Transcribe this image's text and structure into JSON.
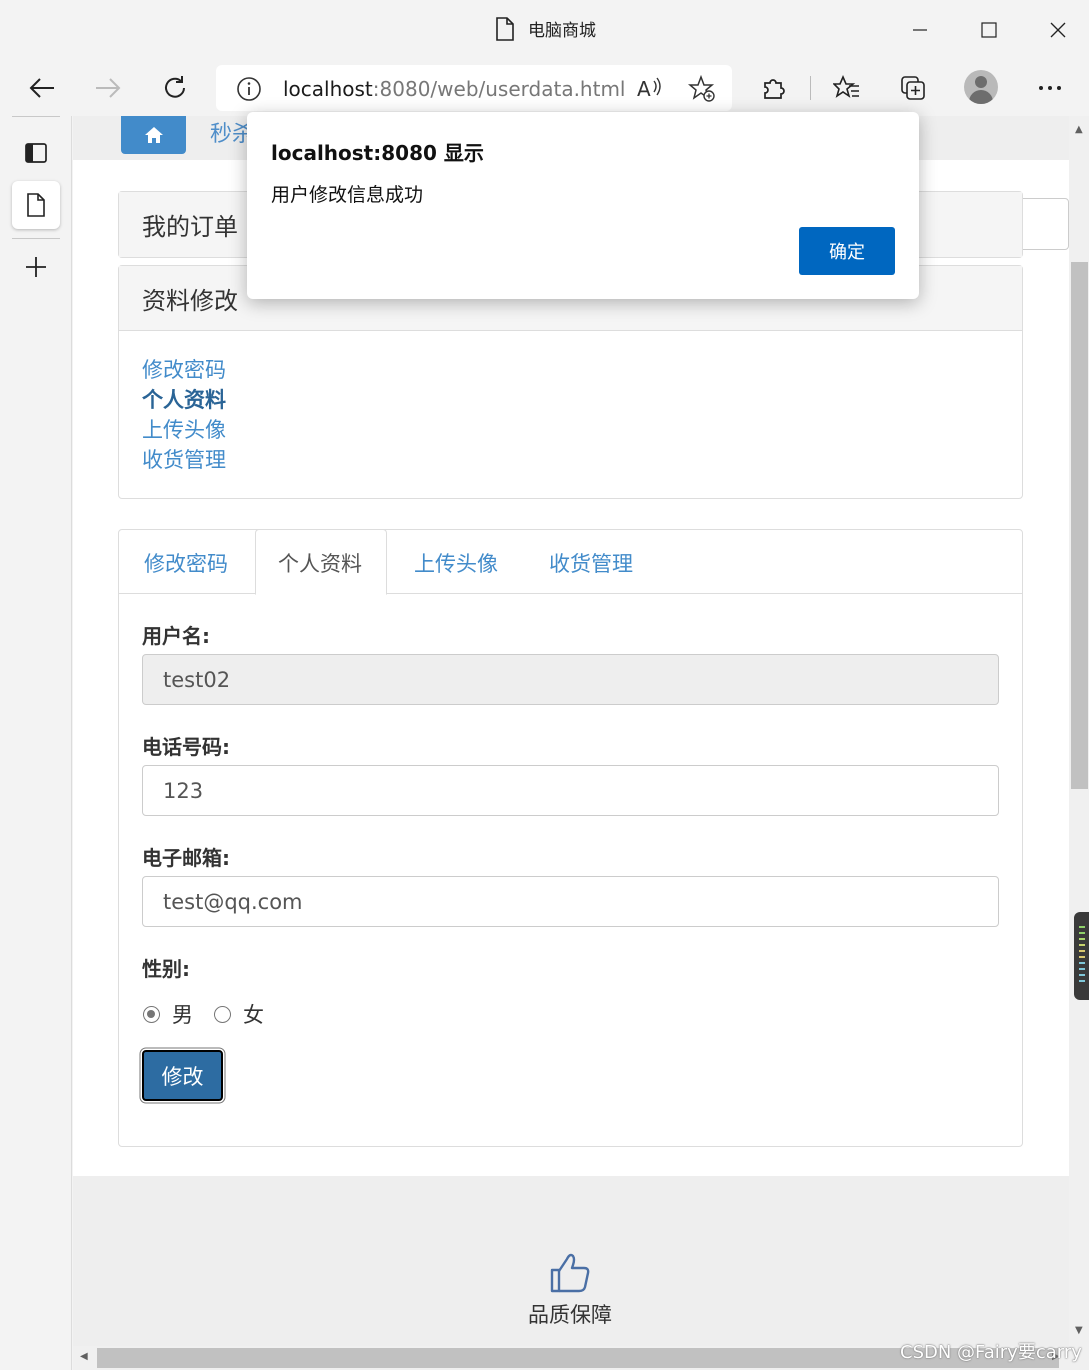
{
  "browser": {
    "tab_title": "电脑商城",
    "url_host": "localhost",
    "url_rest": ":8080/web/userdata.html"
  },
  "page": {
    "nav_peek_text": "秒杀",
    "orders_panel_title": "我的订单",
    "profile_panel_title": "资料修改",
    "menu_links": [
      {
        "label": "修改密码",
        "active": false
      },
      {
        "label": "个人资料",
        "active": true
      },
      {
        "label": "上传头像",
        "active": false
      },
      {
        "label": "收货管理",
        "active": false
      }
    ],
    "tabs": [
      {
        "label": "修改密码",
        "active": false
      },
      {
        "label": "个人资料",
        "active": true
      },
      {
        "label": "上传头像",
        "active": false
      },
      {
        "label": "收货管理",
        "active": false
      }
    ],
    "form": {
      "username_label": "用户名:",
      "username_value": "test02",
      "phone_label": "电话号码:",
      "phone_value": "123",
      "email_label": "电子邮箱:",
      "email_value": "test@qq.com",
      "gender_label": "性别:",
      "gender_male": "男",
      "gender_female": "女",
      "gender_selected": "男",
      "submit_label": "修改"
    },
    "footer_text": "品质保障"
  },
  "dialog": {
    "title": "localhost:8080 显示",
    "message": "用户修改信息成功",
    "ok_label": "确定"
  },
  "watermark": "CSDN @Fairy要carry",
  "colors": {
    "link": "#428bca",
    "primary_button": "#2d6ca2",
    "dialog_button": "#0067c0"
  }
}
